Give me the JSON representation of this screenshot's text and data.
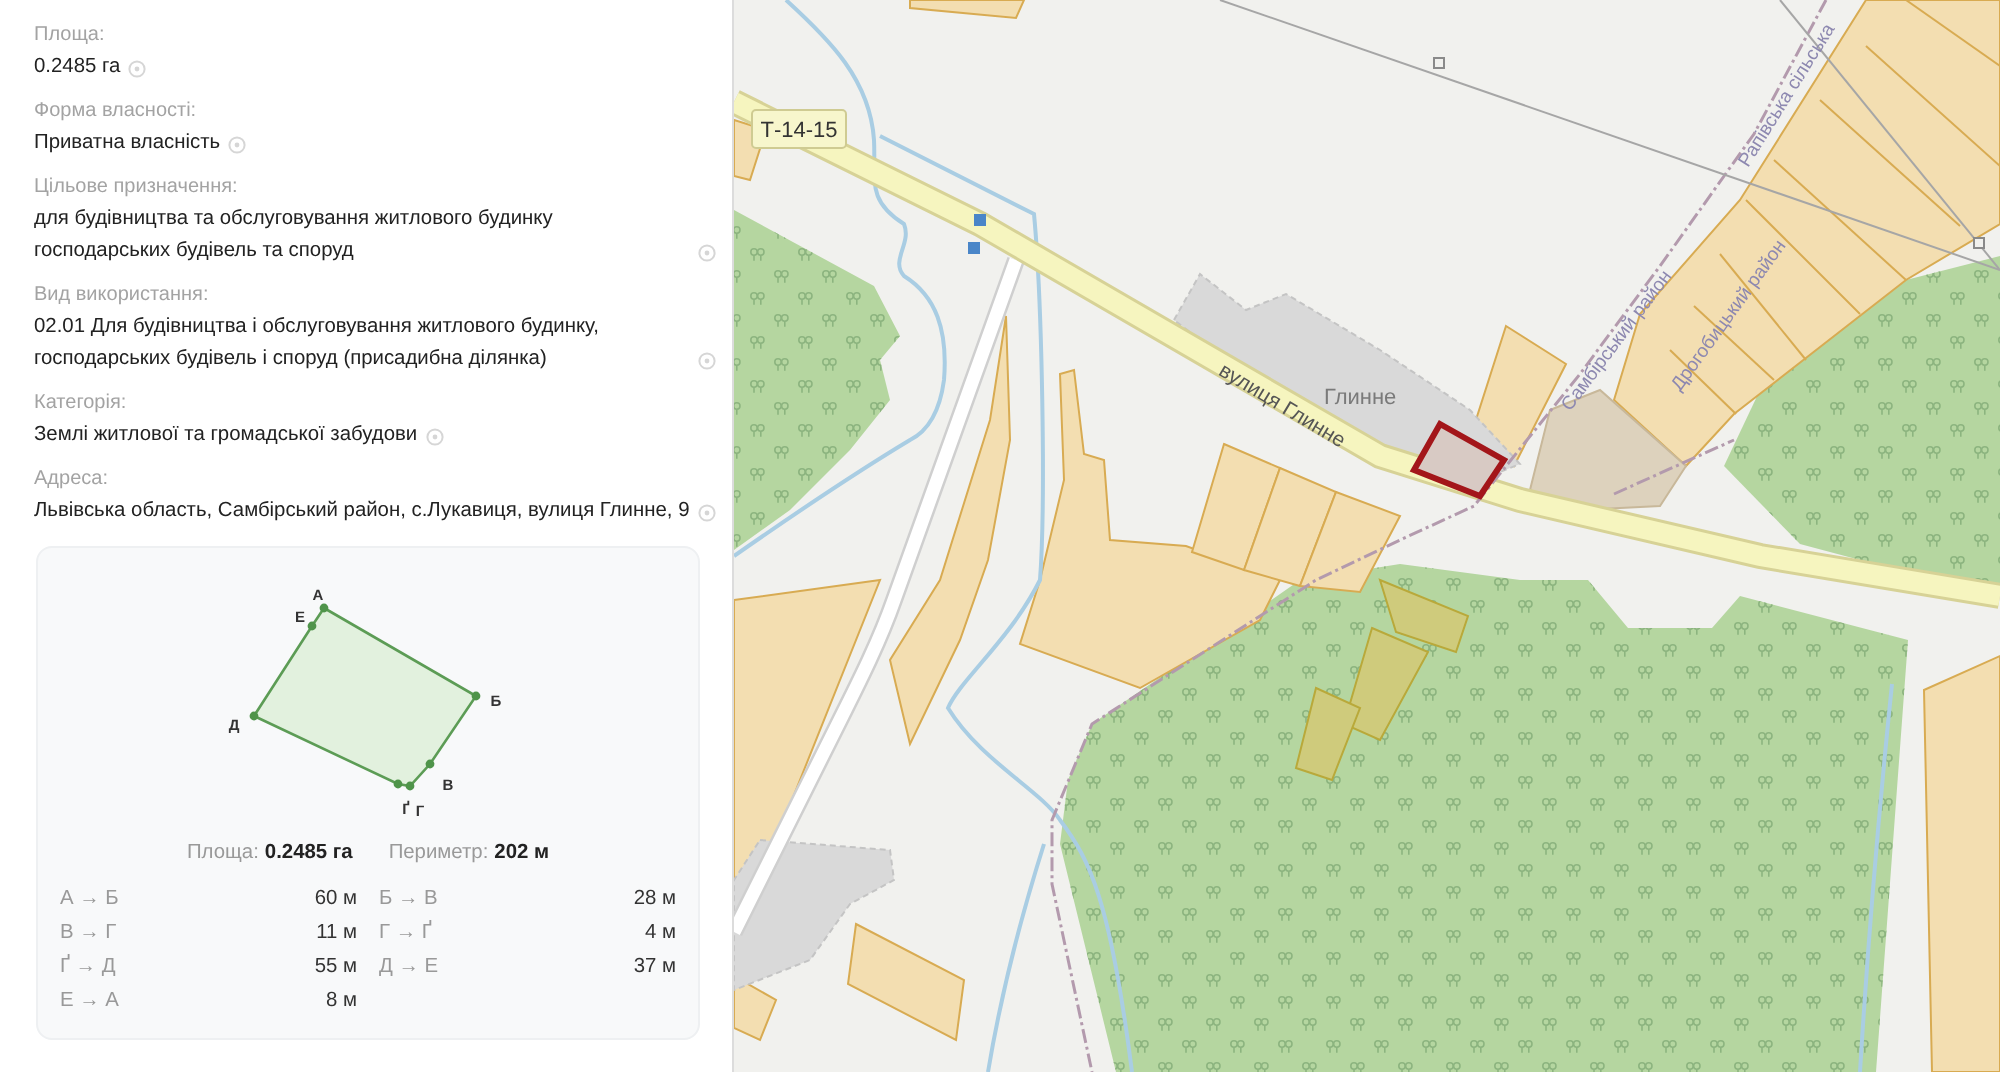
{
  "property": {
    "fields": [
      {
        "label": "Площа:",
        "value": "0.2485 га"
      },
      {
        "label": "Форма власності:",
        "value": "Приватна власність"
      },
      {
        "label": "Цільове призначення:",
        "value": "для будівництва та обслуговування житлового будинку господарських будівель та споруд"
      },
      {
        "label": "Вид використання:",
        "value": "02.01 Для будівництва і обслуговування житлового будинку, господарських будівель і споруд (присадибна ділянка)"
      },
      {
        "label": "Категорія:",
        "value": "Землі житлової та громадської забудови"
      },
      {
        "label": "Адреса:",
        "value": "Львівська область, Самбірський район, с.Лукавиця, вулиця Глинне, 9"
      }
    ]
  },
  "plot_card": {
    "vertices": [
      "А",
      "Б",
      "В",
      "Г",
      "Ґ",
      "Д",
      "Е"
    ],
    "summary": [
      {
        "label": "Площа:",
        "value": "0.2485 га"
      },
      {
        "label": "Периметр:",
        "value": "202 м"
      }
    ],
    "segments": [
      {
        "label": "А → Б",
        "value": "60 м"
      },
      {
        "label": "Б → В",
        "value": "28 м"
      },
      {
        "label": "В → Г",
        "value": "11 м"
      },
      {
        "label": "Г → Ґ",
        "value": "4 м"
      },
      {
        "label": "Ґ → Д",
        "value": "55 м"
      },
      {
        "label": "Д → Е",
        "value": "37 м"
      },
      {
        "label": "Е → А",
        "value": "8 м"
      }
    ]
  },
  "map": {
    "road_number": "Т-14-15",
    "street_name": "вулиця Глинне",
    "place_name": "Глинне",
    "district_labels": [
      "Самбірський район",
      "Дрогобицький район",
      "Рапівська сільська"
    ]
  }
}
